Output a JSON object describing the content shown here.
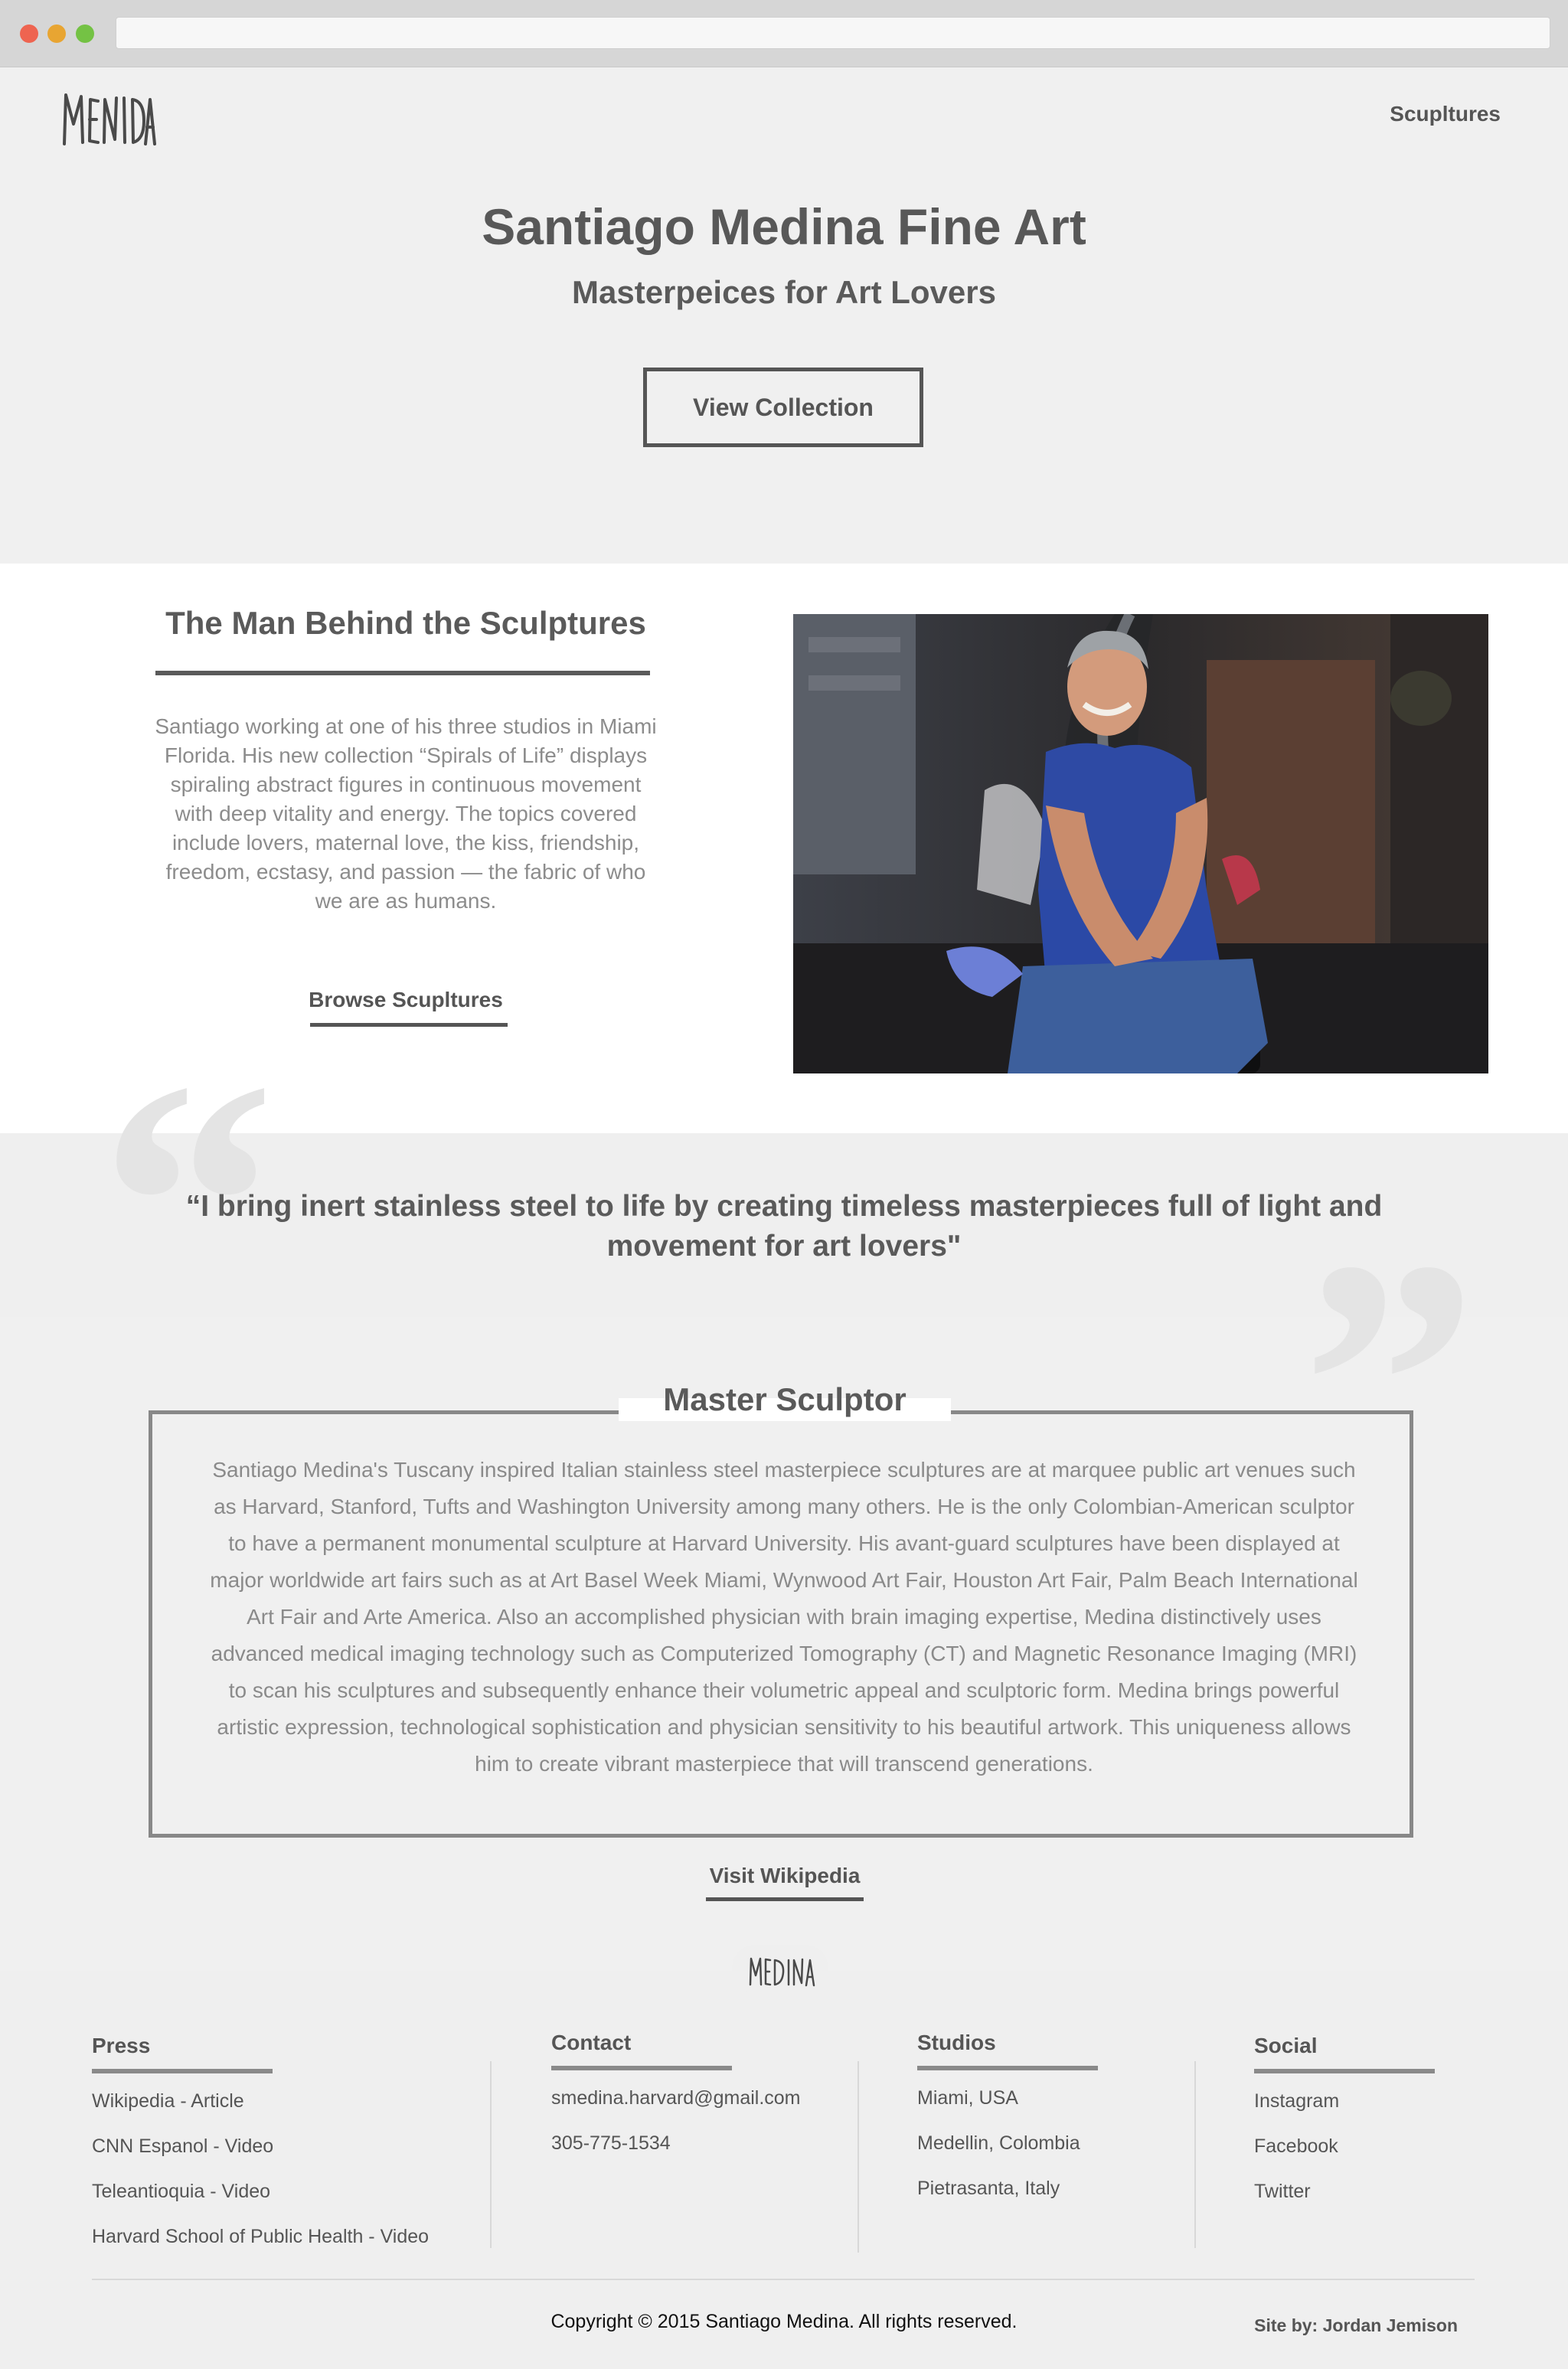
{
  "browser": {
    "url": ""
  },
  "header": {
    "logo_text": "MENIDA",
    "nav_link": "Scupltures"
  },
  "hero": {
    "title": "Santiago Medina Fine Art",
    "subtitle": "Masterpeices for Art Lovers",
    "button": "View Collection"
  },
  "about": {
    "heading": "The Man Behind the Sculptures",
    "text": "Santiago working at one of his three studios in Miami Florida. His new collection “Spirals of Life” displays spiraling abstract figures in continuous movement with deep vitality and energy. The topics covered include lovers, maternal love, the kiss, friendship, freedom, ecstasy, and passion — the fabric of who we are as humans.",
    "link": "Browse Scupltures"
  },
  "quote": {
    "text": "“I bring inert stainless steel to life by creating timeless masterpieces full of light and movement for art lovers\""
  },
  "master": {
    "title": "Master Sculptor",
    "text": "Santiago Medina's Tuscany inspired Italian stainless steel masterpiece sculptures are at marquee public art venues such as Harvard, Stanford, Tufts and Washington University among many others. He is the only Colombian-American sculptor to have a permanent monumental sculpture at Harvard University. His avant-guard sculptures have been displayed at major worldwide art fairs such as at Art Basel Week Miami, Wynwood Art Fair, Houston Art Fair, Palm Beach International Art Fair and Arte America. Also an accomplished physician with brain imaging expertise, Medina distinctively uses advanced medical imaging technology such as Computerized Tomography (CT) and Magnetic Resonance Imaging (MRI) to scan his sculptures and subsequently enhance their volumetric appeal and sculptoric form. Medina brings powerful artistic expression, technological sophistication and physician sensitivity to his beautiful artwork. This uniqueness allows him to create vibrant masterpiece that will transcend generations.",
    "link": "Visit Wikipedia"
  },
  "footer": {
    "logo_text": "MEDINA",
    "columns": [
      {
        "title": "Press",
        "items": [
          "Wikipedia - Article",
          "CNN Espanol - Video",
          "Teleantioquia - Video",
          "Harvard School of Public Health - Video"
        ]
      },
      {
        "title": "Contact",
        "items": [
          "smedina.harvard@gmail.com",
          "305-775-1534"
        ]
      },
      {
        "title": "Studios",
        "items": [
          "Miami, USA",
          "Medellin, Colombia",
          "Pietrasanta, Italy"
        ]
      },
      {
        "title": "Social",
        "items": [
          "Instagram",
          "Facebook",
          "Twitter"
        ]
      }
    ],
    "copyright": "Copyright © 2015 Santiago Medina. All rights reserved.",
    "site_by": "Site by: Jordan Jemison"
  },
  "colors": {
    "accent": "#585858",
    "muted_text": "#8c8c8c",
    "background": "#f0f0f0"
  }
}
